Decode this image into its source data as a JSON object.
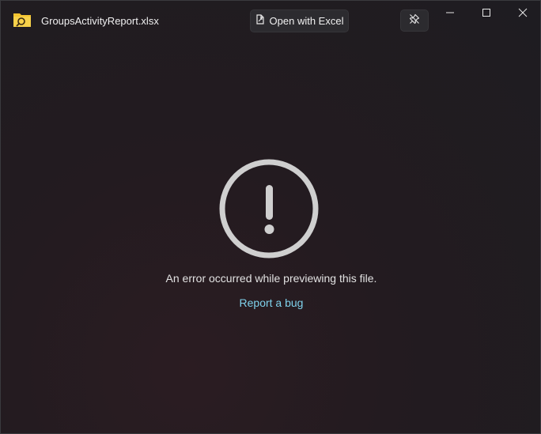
{
  "window": {
    "title": "GroupsActivityReport.xlsx",
    "app_icon": "folder-search-icon"
  },
  "toolbar": {
    "open_button_label": "Open with Excel",
    "open_button_icon": "open-file-icon",
    "pin_icon": "pin-icon"
  },
  "caption_buttons": {
    "minimize_icon": "minimize-icon",
    "maximize_icon": "maximize-icon",
    "close_icon": "close-icon"
  },
  "error": {
    "icon": "exclamation-circle-icon",
    "message": "An error occurred while previewing this file.",
    "link_label": "Report a bug"
  },
  "colors": {
    "background": "#231b20",
    "link": "#7fd2ec",
    "folder": "#f4c430",
    "icon_gray": "#cfcfcf"
  }
}
